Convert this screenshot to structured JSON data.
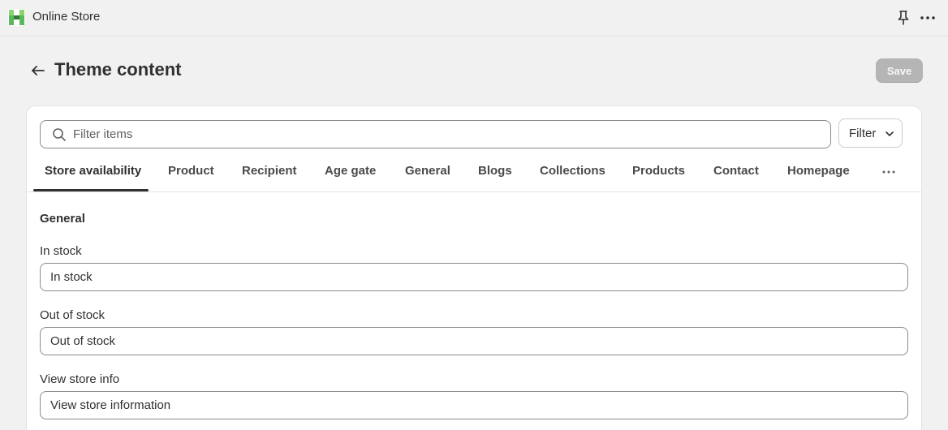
{
  "app": {
    "title": "Online Store",
    "icon": "online-store-icon",
    "brand_color": "#4caf50"
  },
  "topbar": {
    "pin_icon": "pin-icon",
    "more_icon": "more-horizontal-icon"
  },
  "page": {
    "title": "Theme content",
    "back_icon": "arrow-left-icon",
    "save_label": "Save"
  },
  "search": {
    "placeholder": "Filter items",
    "value": "",
    "icon": "search-icon"
  },
  "filter": {
    "label": "Filter",
    "icon": "chevron-down-icon"
  },
  "tabs": [
    {
      "label": "Store availability",
      "active": true
    },
    {
      "label": "Product",
      "active": false
    },
    {
      "label": "Recipient",
      "active": false
    },
    {
      "label": "Age gate",
      "active": false
    },
    {
      "label": "General",
      "active": false
    },
    {
      "label": "Blogs",
      "active": false
    },
    {
      "label": "Collections",
      "active": false
    },
    {
      "label": "Products",
      "active": false
    },
    {
      "label": "Contact",
      "active": false
    },
    {
      "label": "Homepage",
      "active": false
    }
  ],
  "tabs_more_icon": "more-horizontal-icon",
  "section": {
    "title": "General",
    "fields": [
      {
        "label": "In stock",
        "value": "In stock"
      },
      {
        "label": "Out of stock",
        "value": "Out of stock"
      },
      {
        "label": "View store info",
        "value": "View store information"
      }
    ]
  }
}
